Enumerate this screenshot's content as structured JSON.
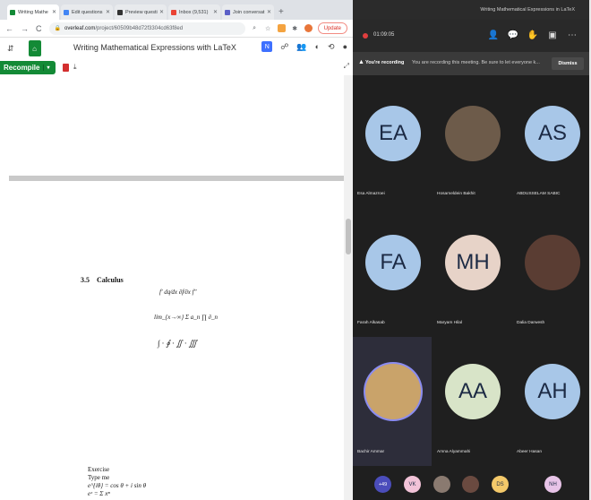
{
  "browser": {
    "tabs": [
      {
        "label": "Writing Mathe",
        "color": "#138a36",
        "active": true
      },
      {
        "label": "Edit questions",
        "color": "#4285f4",
        "active": false
      },
      {
        "label": "Preview questi",
        "color": "#333333",
        "active": false
      },
      {
        "label": "Inbox (9,531)",
        "color": "#ea4335",
        "active": false
      },
      {
        "label": "Join conversat",
        "color": "#5b5fc7",
        "active": false
      }
    ],
    "url_host": "overleaf.com",
    "url_path": "/project/60509b48d72f3304cd63f8ed",
    "update_label": "Update",
    "nav": {
      "back": "←",
      "forward": "→",
      "reload": "C"
    }
  },
  "overleaf": {
    "title": "Writing Mathematical Expressions with LaTeX",
    "logo_letter": "N",
    "recompile_label": "Recompile",
    "page": {
      "section_number": "3.5",
      "section_title": "Calculus",
      "math_line1": "f′  dq⁄dx  ∂f⁄∂x  f″",
      "math_line2": "lim_{x→∞} Σ a_n  ∏ ∂_n",
      "math_line3": "∫ · ∮ · ∬ · ∭",
      "exercise_label": "Exercise",
      "exercise_line2": "Type me",
      "exercise_line3": "e^{iθ} = cos θ + i sin θ",
      "exercise_line4": "eˣ = Σ xⁿ"
    }
  },
  "teams": {
    "window_title": "Writing Mathematical Expressions in LaTeX",
    "timer": "01:09:05",
    "banner_title": "You're recording",
    "banner_message": "You are recording this meeting. Be sure to let everyone k...",
    "dismiss_label": "Dismiss",
    "participants": [
      {
        "initials": "EA",
        "name": "Esa Almazroei",
        "color": "#a8c7e8",
        "photo": false
      },
      {
        "initials": "",
        "name": "Hosameldein Bakhit",
        "color": "#6d5b4a",
        "photo": true
      },
      {
        "initials": "AS",
        "name": "ABDUSSELAM SABIC",
        "color": "#a8c7e8",
        "photo": false
      },
      {
        "initials": "FA",
        "name": "Farah Alkasab",
        "color": "#a8c7e8",
        "photo": false
      },
      {
        "initials": "MH",
        "name": "Maryam Hilal",
        "color": "#e7d3c8",
        "photo": false
      },
      {
        "initials": "",
        "name": "Dalia Darwesh",
        "color": "#5a3d33",
        "photo": true
      },
      {
        "initials": "",
        "name": "Bachir Ammar",
        "color": "#c9a36a",
        "photo": true
      },
      {
        "initials": "AA",
        "name": "Amna Alyammahi",
        "color": "#d8e4c8",
        "photo": false
      },
      {
        "initials": "AH",
        "name": "Abeer Hasan",
        "color": "#a8c7e8",
        "photo": false
      }
    ],
    "overflow_count": "+49",
    "bottom_avatars": [
      {
        "initials": "VK",
        "color": "#f2c3d8"
      },
      {
        "initials": "",
        "color": "#8a7a70"
      },
      {
        "initials": "",
        "color": "#6a4a40"
      },
      {
        "initials": "DS",
        "color": "#f4c96a"
      },
      {
        "initials": "NH",
        "color": "#e8c4e8"
      }
    ]
  }
}
